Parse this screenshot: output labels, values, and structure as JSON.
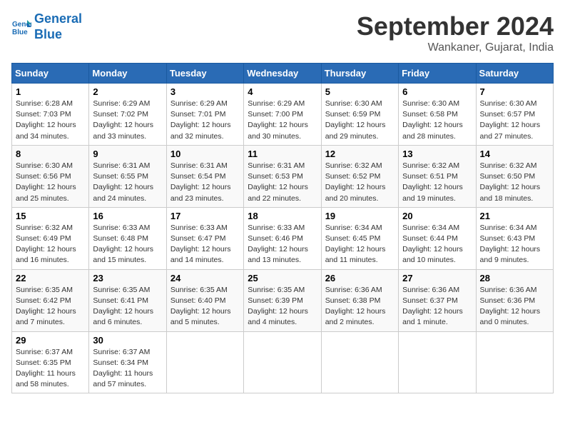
{
  "header": {
    "logo_line1": "General",
    "logo_line2": "Blue",
    "month_year": "September 2024",
    "location": "Wankaner, Gujarat, India"
  },
  "days_of_week": [
    "Sunday",
    "Monday",
    "Tuesday",
    "Wednesday",
    "Thursday",
    "Friday",
    "Saturday"
  ],
  "weeks": [
    [
      {
        "day": "1",
        "sunrise": "6:28 AM",
        "sunset": "7:03 PM",
        "daylight": "12 hours and 34 minutes."
      },
      {
        "day": "2",
        "sunrise": "6:29 AM",
        "sunset": "7:02 PM",
        "daylight": "12 hours and 33 minutes."
      },
      {
        "day": "3",
        "sunrise": "6:29 AM",
        "sunset": "7:01 PM",
        "daylight": "12 hours and 32 minutes."
      },
      {
        "day": "4",
        "sunrise": "6:29 AM",
        "sunset": "7:00 PM",
        "daylight": "12 hours and 30 minutes."
      },
      {
        "day": "5",
        "sunrise": "6:30 AM",
        "sunset": "6:59 PM",
        "daylight": "12 hours and 29 minutes."
      },
      {
        "day": "6",
        "sunrise": "6:30 AM",
        "sunset": "6:58 PM",
        "daylight": "12 hours and 28 minutes."
      },
      {
        "day": "7",
        "sunrise": "6:30 AM",
        "sunset": "6:57 PM",
        "daylight": "12 hours and 27 minutes."
      }
    ],
    [
      {
        "day": "8",
        "sunrise": "6:30 AM",
        "sunset": "6:56 PM",
        "daylight": "12 hours and 25 minutes."
      },
      {
        "day": "9",
        "sunrise": "6:31 AM",
        "sunset": "6:55 PM",
        "daylight": "12 hours and 24 minutes."
      },
      {
        "day": "10",
        "sunrise": "6:31 AM",
        "sunset": "6:54 PM",
        "daylight": "12 hours and 23 minutes."
      },
      {
        "day": "11",
        "sunrise": "6:31 AM",
        "sunset": "6:53 PM",
        "daylight": "12 hours and 22 minutes."
      },
      {
        "day": "12",
        "sunrise": "6:32 AM",
        "sunset": "6:52 PM",
        "daylight": "12 hours and 20 minutes."
      },
      {
        "day": "13",
        "sunrise": "6:32 AM",
        "sunset": "6:51 PM",
        "daylight": "12 hours and 19 minutes."
      },
      {
        "day": "14",
        "sunrise": "6:32 AM",
        "sunset": "6:50 PM",
        "daylight": "12 hours and 18 minutes."
      }
    ],
    [
      {
        "day": "15",
        "sunrise": "6:32 AM",
        "sunset": "6:49 PM",
        "daylight": "12 hours and 16 minutes."
      },
      {
        "day": "16",
        "sunrise": "6:33 AM",
        "sunset": "6:48 PM",
        "daylight": "12 hours and 15 minutes."
      },
      {
        "day": "17",
        "sunrise": "6:33 AM",
        "sunset": "6:47 PM",
        "daylight": "12 hours and 14 minutes."
      },
      {
        "day": "18",
        "sunrise": "6:33 AM",
        "sunset": "6:46 PM",
        "daylight": "12 hours and 13 minutes."
      },
      {
        "day": "19",
        "sunrise": "6:34 AM",
        "sunset": "6:45 PM",
        "daylight": "12 hours and 11 minutes."
      },
      {
        "day": "20",
        "sunrise": "6:34 AM",
        "sunset": "6:44 PM",
        "daylight": "12 hours and 10 minutes."
      },
      {
        "day": "21",
        "sunrise": "6:34 AM",
        "sunset": "6:43 PM",
        "daylight": "12 hours and 9 minutes."
      }
    ],
    [
      {
        "day": "22",
        "sunrise": "6:35 AM",
        "sunset": "6:42 PM",
        "daylight": "12 hours and 7 minutes."
      },
      {
        "day": "23",
        "sunrise": "6:35 AM",
        "sunset": "6:41 PM",
        "daylight": "12 hours and 6 minutes."
      },
      {
        "day": "24",
        "sunrise": "6:35 AM",
        "sunset": "6:40 PM",
        "daylight": "12 hours and 5 minutes."
      },
      {
        "day": "25",
        "sunrise": "6:35 AM",
        "sunset": "6:39 PM",
        "daylight": "12 hours and 4 minutes."
      },
      {
        "day": "26",
        "sunrise": "6:36 AM",
        "sunset": "6:38 PM",
        "daylight": "12 hours and 2 minutes."
      },
      {
        "day": "27",
        "sunrise": "6:36 AM",
        "sunset": "6:37 PM",
        "daylight": "12 hours and 1 minute."
      },
      {
        "day": "28",
        "sunrise": "6:36 AM",
        "sunset": "6:36 PM",
        "daylight": "12 hours and 0 minutes."
      }
    ],
    [
      {
        "day": "29",
        "sunrise": "6:37 AM",
        "sunset": "6:35 PM",
        "daylight": "11 hours and 58 minutes."
      },
      {
        "day": "30",
        "sunrise": "6:37 AM",
        "sunset": "6:34 PM",
        "daylight": "11 hours and 57 minutes."
      },
      null,
      null,
      null,
      null,
      null
    ]
  ]
}
